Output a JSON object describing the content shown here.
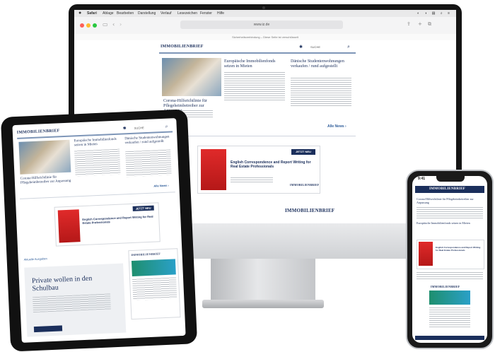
{
  "site": {
    "logo": "IMMOBILIENBRIEF",
    "search_label": "SUCHE",
    "article1": {
      "headline": "Europäische Immobilienfonds setzen in Mieten"
    },
    "article2": {
      "headline": "Dänische Studentenwohnungen verkaufen / rund aufgestellt"
    },
    "article3": {
      "headline": "Corona-Hilfsrichtlinie für Pflegeheimbetreiber zur Anpassung"
    },
    "more_label": "Alle News ›",
    "ad": {
      "badge": "JETZT NEU",
      "title": "English Correspondence and Report Writing for Real Estate Professionals",
      "subtitle": "Neue Ausgabe"
    },
    "section_label": "Aktuelle Ausgaben",
    "feature_headline": "Private wollen in den Schulbau",
    "footer_logo": "IMMOBILIENBRIEF"
  },
  "browser": {
    "url": "www.iz.de",
    "infobar": "Sicherheitsverbindung – Diese Seite ist verschlüsselt"
  },
  "menubar": {
    "items": [
      "Safari",
      "Ablage",
      "Bearbeiten",
      "Darstellung",
      "Verlauf",
      "Lesezeichen",
      "Fenster",
      "Hilfe"
    ]
  },
  "phone": {
    "time": "9:41",
    "header_logo": "IMMOBILIENBRIEF"
  },
  "colors": {
    "brand": "#1b2f5c",
    "accent": "#e02a2a",
    "link": "#2f5d9a"
  }
}
